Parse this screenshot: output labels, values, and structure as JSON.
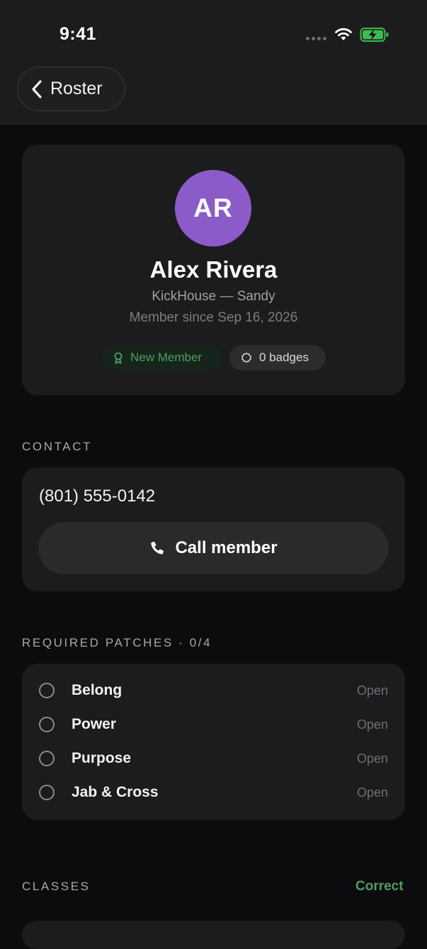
{
  "status_bar": {
    "time": "9:41"
  },
  "nav": {
    "back_label": "Roster"
  },
  "profile": {
    "initials": "AR",
    "avatar_color": "#8b5cc9",
    "name": "Alex Rivera",
    "gym": "KickHouse — Sandy",
    "member_since": "Member since Sep 16, 2026",
    "tags": {
      "new_member": "New Member",
      "badges": "0 badges"
    }
  },
  "contact": {
    "section_label": "CONTACT",
    "phone": "(801) 555-0142",
    "call_label": "Call member"
  },
  "patches": {
    "section_label": "REQUIRED PATCHES · 0/4",
    "items": [
      {
        "name": "Belong",
        "status": "Open"
      },
      {
        "name": "Power",
        "status": "Open"
      },
      {
        "name": "Purpose",
        "status": "Open"
      },
      {
        "name": "Jab & Cross",
        "status": "Open"
      }
    ]
  },
  "classes": {
    "section_label": "CLASSES",
    "action_label": "Correct"
  },
  "colors": {
    "accent_green": "#4f9c62",
    "background": "#0c0c0e",
    "card": "#1c1c1e"
  }
}
